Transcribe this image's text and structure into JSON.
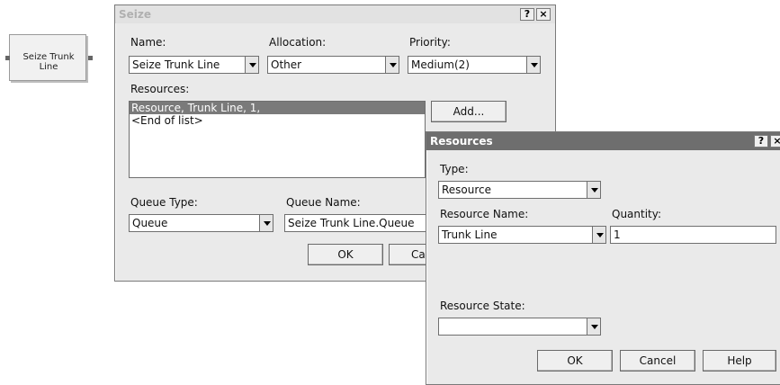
{
  "canvas": {
    "module_label": "Seize Trunk Line"
  },
  "seize_dialog": {
    "title": "Seize",
    "help_button": "?",
    "close_button": "×",
    "name_label": "Name:",
    "name_value": "Seize Trunk Line",
    "allocation_label": "Allocation:",
    "allocation_value": "Other",
    "priority_label": "Priority:",
    "priority_value": "Medium(2)",
    "resources_label": "Resources:",
    "resources_list": [
      "Resource, Trunk Line, 1,",
      "<End of list>"
    ],
    "add_button": "Add...",
    "queue_type_label": "Queue Type:",
    "queue_type_value": "Queue",
    "queue_name_label": "Queue Name:",
    "queue_name_value": "Seize Trunk Line.Queue",
    "ok_button": "OK",
    "cancel_button_partial": "Ca"
  },
  "resources_dialog": {
    "title": "Resources",
    "help_button": "?",
    "close_button": "×",
    "type_label": "Type:",
    "type_value": "Resource",
    "resource_name_label": "Resource Name:",
    "resource_name_value": "Trunk Line",
    "quantity_label": "Quantity:",
    "quantity_value": "1",
    "resource_state_label": "Resource State:",
    "resource_state_value": "",
    "ok_button": "OK",
    "cancel_button": "Cancel",
    "help_text_button": "Help"
  }
}
